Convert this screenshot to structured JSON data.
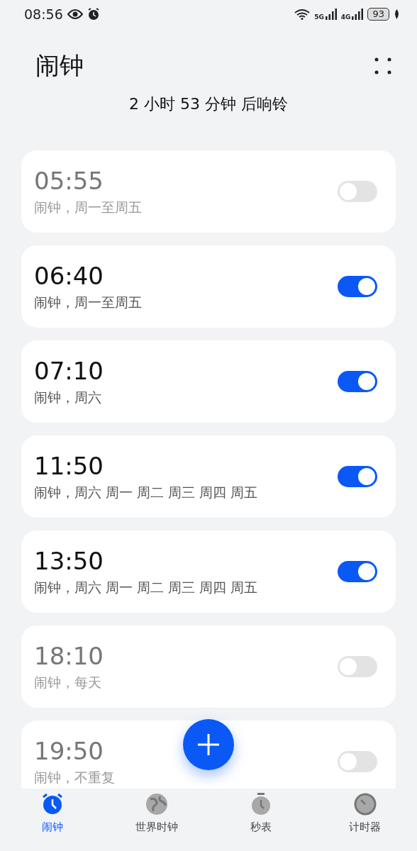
{
  "status_bar": {
    "time": "08:56",
    "network_1": "5G",
    "network_2": "4G",
    "battery": "93"
  },
  "header": {
    "title": "闹钟",
    "next_alarm": "2 小时 53 分钟 后响铃"
  },
  "alarms": [
    {
      "time": "05:55",
      "repeat": "闹钟，周一至周五",
      "on": false
    },
    {
      "time": "06:40",
      "repeat": "闹钟，周一至周五",
      "on": true
    },
    {
      "time": "07:10",
      "repeat": "闹钟，周六",
      "on": true
    },
    {
      "time": "11:50",
      "repeat": "闹钟，周六 周一 周二 周三 周四 周五",
      "on": true
    },
    {
      "time": "13:50",
      "repeat": "闹钟，周六 周一 周二 周三 周四 周五",
      "on": true
    },
    {
      "time": "18:10",
      "repeat": "闹钟，每天",
      "on": false
    },
    {
      "time": "19:50",
      "repeat": "闹钟，不重复",
      "on": false
    }
  ],
  "tabs": [
    {
      "label": "闹钟",
      "kind": "alarm",
      "selected": true
    },
    {
      "label": "世界时钟",
      "kind": "globe",
      "selected": false
    },
    {
      "label": "秒表",
      "kind": "stopwatch",
      "selected": false
    },
    {
      "label": "计时器",
      "kind": "timer",
      "selected": false
    }
  ]
}
